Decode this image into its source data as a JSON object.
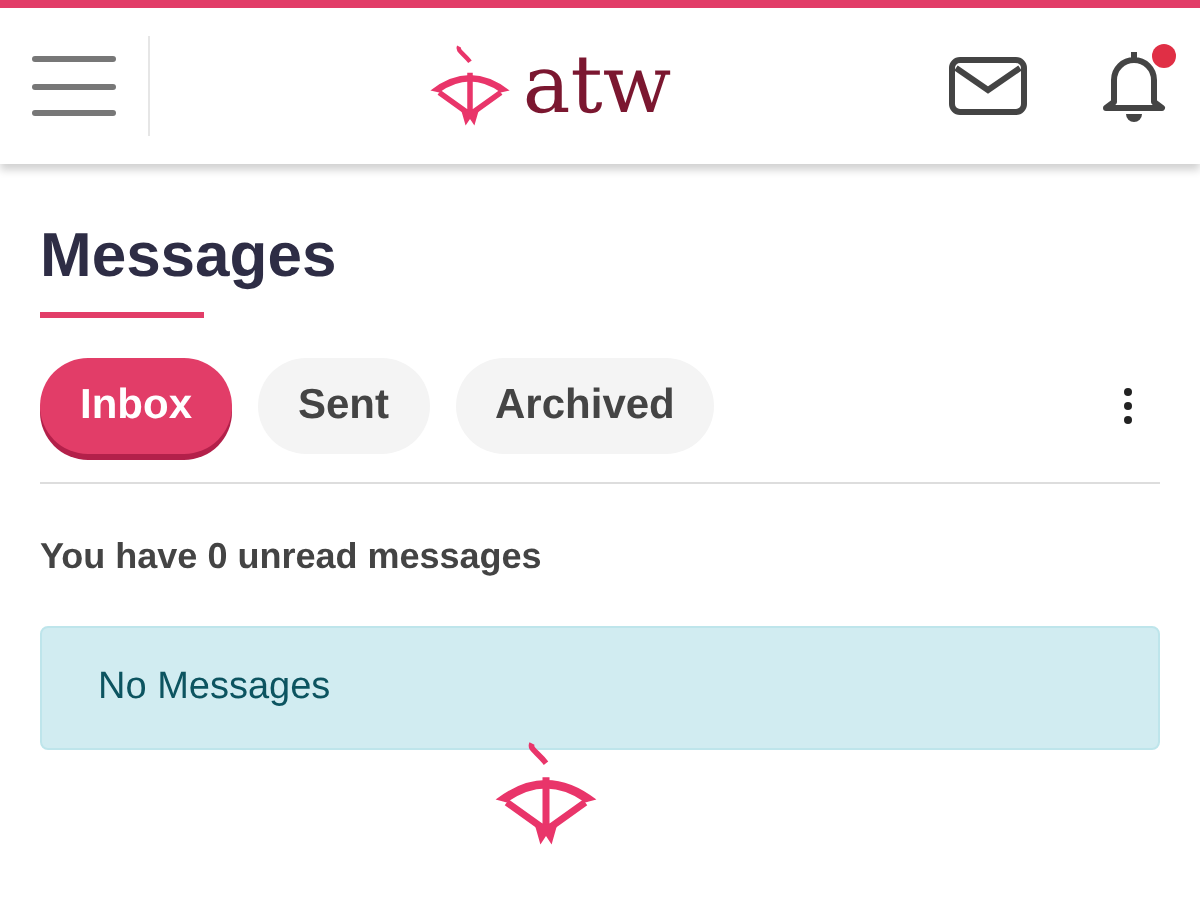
{
  "header": {
    "logo": "atw",
    "notification_badge": true
  },
  "page": {
    "title": "Messages"
  },
  "tabs": [
    {
      "label": "Inbox",
      "selected": true
    },
    {
      "label": "Sent",
      "selected": false
    },
    {
      "label": "Archived",
      "selected": false
    }
  ],
  "summary": "You have 0 unread messages",
  "alert": {
    "text": "No Messages"
  }
}
